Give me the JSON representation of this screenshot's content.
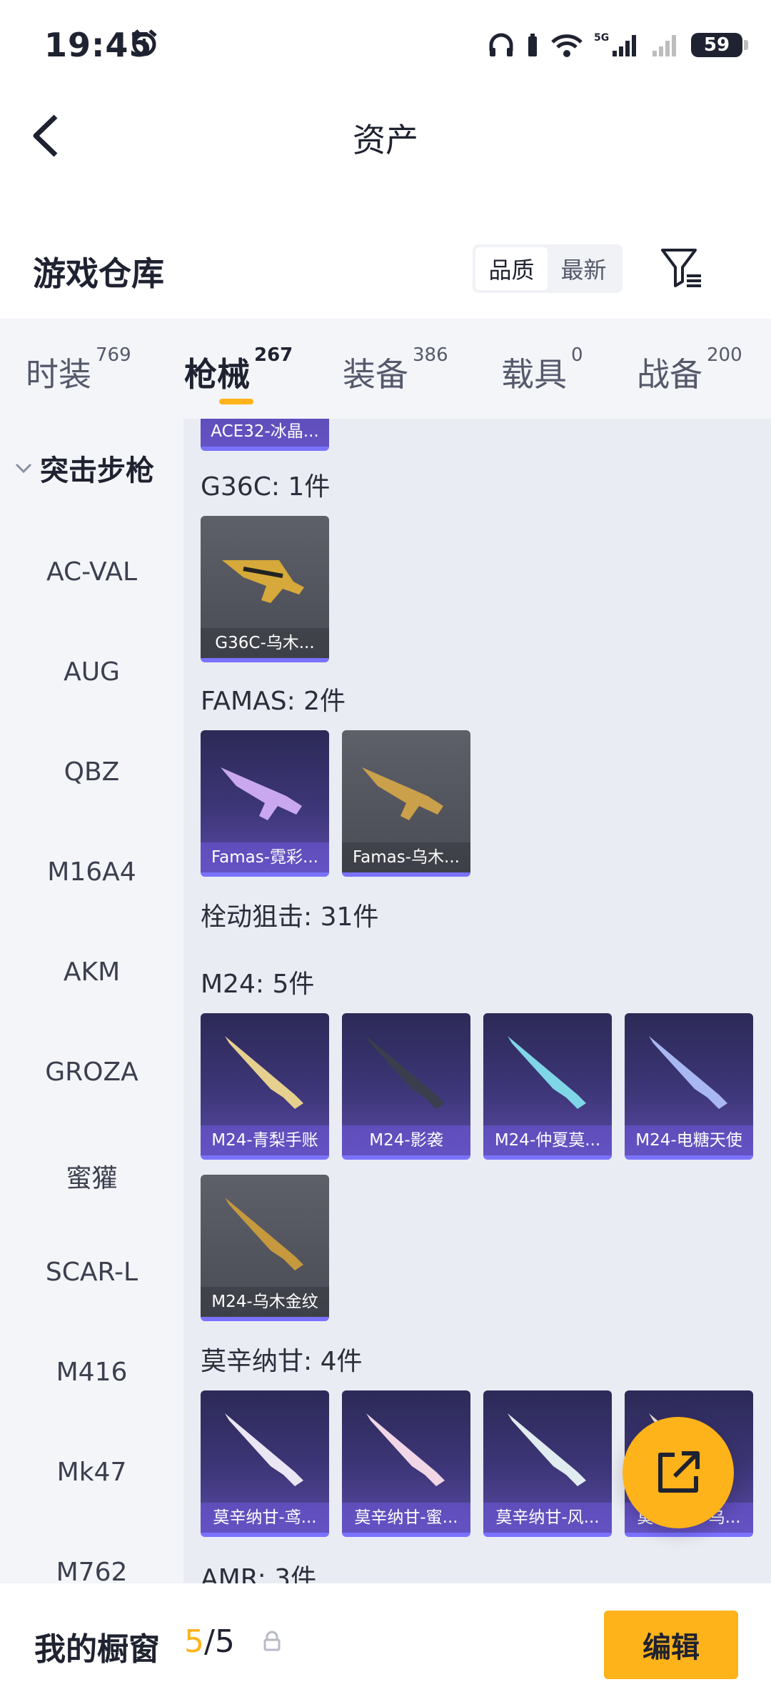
{
  "status_bar": {
    "time": "19:45",
    "battery": "59"
  },
  "header": {
    "title": "资产"
  },
  "warehouse": {
    "title": "游戏仓库",
    "sort_options": [
      "品质",
      "最新"
    ]
  },
  "tabs": [
    {
      "label": "时装",
      "count": "769"
    },
    {
      "label": "枪械",
      "count": "267"
    },
    {
      "label": "装备",
      "count": "386"
    },
    {
      "label": "载具",
      "count": "0"
    },
    {
      "label": "战备",
      "count": "200"
    }
  ],
  "sidebar": {
    "group": "突击步枪",
    "items": [
      "AC-VAL",
      "AUG",
      "QBZ",
      "M16A4",
      "AKM",
      "GROZA",
      "蜜獾",
      "SCAR-L",
      "M416",
      "Mk47",
      "M762"
    ]
  },
  "content": {
    "top_partial_card": "ACE32-冰晶...",
    "sections": [
      {
        "title": "G36C: 1件",
        "items": [
          {
            "label": "G36C-乌木...",
            "style": "grey",
            "color": "#d6a93a"
          }
        ]
      },
      {
        "title": "FAMAS: 2件",
        "items": [
          {
            "label": "Famas-霓彩...",
            "style": "purple",
            "color": "#c9a8f0"
          },
          {
            "label": "Famas-乌木...",
            "style": "grey",
            "color": "#caa04a"
          }
        ]
      },
      {
        "title": "栓动狙击: 31件",
        "items": []
      },
      {
        "title": "M24: 5件",
        "items": [
          {
            "label": "M24-青梨手账",
            "style": "purple",
            "color": "#e6d08e"
          },
          {
            "label": "M24-影袭",
            "style": "purple",
            "color": "#3a3f4e"
          },
          {
            "label": "M24-仲夏莫...",
            "style": "purple",
            "color": "#7fd6e6"
          },
          {
            "label": "M24-电糖天使",
            "style": "purple",
            "color": "#a9b8f2"
          },
          {
            "label": "M24-乌木金纹",
            "style": "grey",
            "color": "#c6993e"
          }
        ]
      },
      {
        "title": "莫辛纳甘: 4件",
        "items": [
          {
            "label": "莫辛纳甘-鸢...",
            "style": "purple",
            "color": "#eae6f3"
          },
          {
            "label": "莫辛纳甘-蜜...",
            "style": "purple",
            "color": "#f1d6e6"
          },
          {
            "label": "莫辛纳甘-风...",
            "style": "purple",
            "color": "#e1ecf1"
          },
          {
            "label": "莫辛纳甘-乌...",
            "style": "purple",
            "color": "#e6dfd6"
          }
        ]
      },
      {
        "title": "AMR: 3件",
        "items": []
      }
    ]
  },
  "bottom_bar": {
    "title": "我的橱窗",
    "count_current": "5",
    "count_sep": "/",
    "count_total": "5",
    "edit_label": "编辑"
  }
}
